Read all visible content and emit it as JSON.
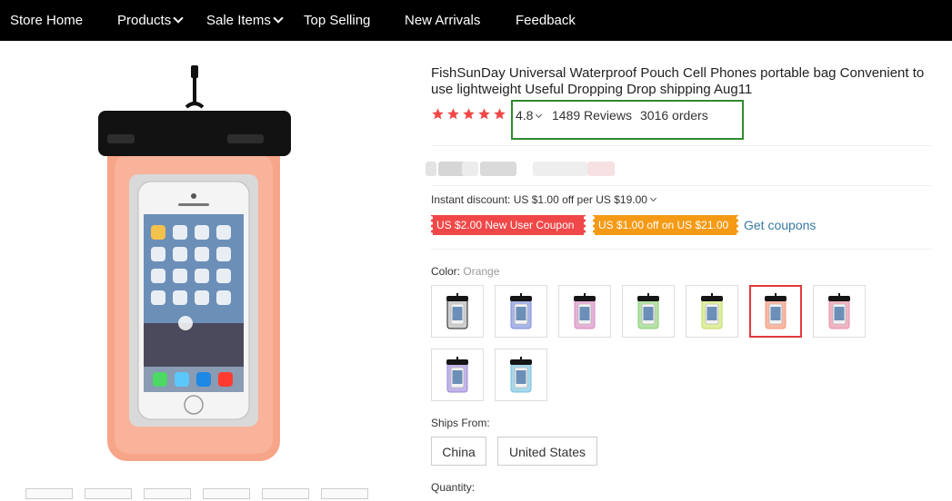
{
  "nav": {
    "items": [
      {
        "label": "Store Home"
      },
      {
        "label": "Products"
      },
      {
        "label": "Sale Items"
      },
      {
        "label": "Top Selling"
      },
      {
        "label": "New Arrivals"
      },
      {
        "label": "Feedback"
      }
    ]
  },
  "product": {
    "title": "FishSunDay Universal Waterproof Pouch Cell Phones portable bag Convenient to use lightweight Useful Dropping Drop shipping Aug11",
    "rating": "4.8",
    "stars": 5,
    "reviews": "1489 Reviews",
    "orders": "3016 orders",
    "instant_discount": "Instant discount: US $1.00 off per US $19.00",
    "coupons": [
      "US $2.00 New User Coupon",
      "US $1.00 off on US $21.00"
    ],
    "get_coupons": "Get coupons",
    "color_label": "Color:",
    "color_value": "Orange",
    "colors": [
      {
        "name": "black",
        "tint": "#cfcfcf",
        "edge": "#222222"
      },
      {
        "name": "blue",
        "tint": "#a9b4e8",
        "edge": "#7f8fd6"
      },
      {
        "name": "pink",
        "tint": "#e7b2d8",
        "edge": "#d58bc0"
      },
      {
        "name": "green",
        "tint": "#b4e3a5",
        "edge": "#8acb74"
      },
      {
        "name": "yellow",
        "tint": "#dff0a0",
        "edge": "#bcd760"
      },
      {
        "name": "orange",
        "tint": "#f7b9a4",
        "edge": "#f19a7d",
        "selected": true
      },
      {
        "name": "rose",
        "tint": "#f0b4c4",
        "edge": "#e88fa8"
      },
      {
        "name": "purple",
        "tint": "#c2b5e8",
        "edge": "#9b87d8"
      },
      {
        "name": "teal",
        "tint": "#a6d8ea",
        "edge": "#77c1dc"
      }
    ],
    "ships_from_label": "Ships From:",
    "ships_from": [
      "China",
      "United States"
    ],
    "quantity_label": "Quantity:"
  },
  "colors": {
    "nav_bg": "#000000",
    "star": "#f04848",
    "coupon_red": "#f04848",
    "coupon_orange": "#f59a15",
    "highlight": "#2e8b2e",
    "link": "#3a7aa4",
    "selected_border": "#e4393c"
  }
}
